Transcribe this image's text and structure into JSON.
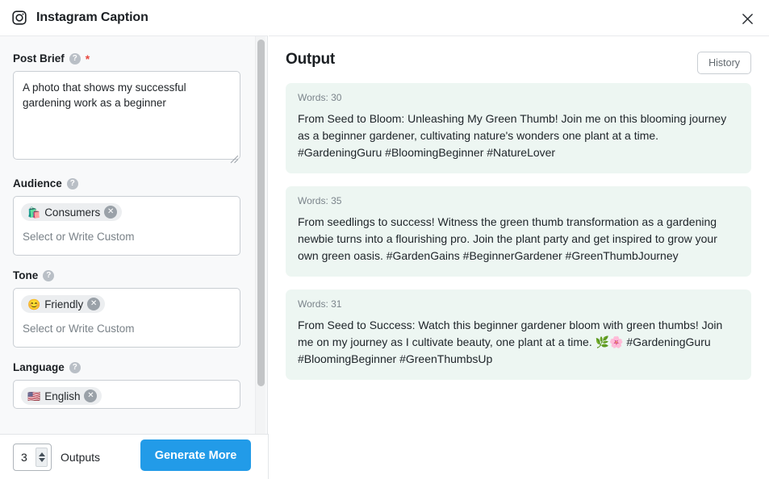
{
  "window": {
    "title": "Instagram Caption",
    "app_icon": "instagram-icon",
    "close_icon": "close-icon"
  },
  "form": {
    "post_brief": {
      "label": "Post Brief",
      "help_icon": "help-icon",
      "required_marker": "*",
      "value": "A photo that shows my successful gardening work as a beginner",
      "placeholder": ""
    },
    "audience": {
      "label": "Audience",
      "help_icon": "help-icon",
      "chips": [
        {
          "emoji": "🛍️",
          "label": "Consumers",
          "remove_icon": "close-circle-icon"
        }
      ],
      "placeholder": "Select or Write Custom"
    },
    "tone": {
      "label": "Tone",
      "help_icon": "help-icon",
      "chips": [
        {
          "emoji": "😊",
          "label": "Friendly",
          "remove_icon": "close-circle-icon"
        }
      ],
      "placeholder": "Select or Write Custom"
    },
    "language": {
      "label": "Language",
      "help_icon": "help-icon",
      "chips": [
        {
          "emoji": "🇺🇸",
          "label": "English",
          "remove_icon": "close-circle-icon"
        }
      ]
    }
  },
  "footer": {
    "outputs_count": "3",
    "outputs_label": "Outputs",
    "generate_label": "Generate More",
    "stepper_up_icon": "chevron-up-icon",
    "stepper_down_icon": "chevron-down-icon"
  },
  "output": {
    "title": "Output",
    "history_label": "History",
    "cards": [
      {
        "words_label": "Words: 30",
        "text": "From Seed to Bloom: Unleashing My Green Thumb! Join me on this blooming journey as a beginner gardener, cultivating nature's wonders one plant at a time. #GardeningGuru #BloomingBeginner #NatureLover"
      },
      {
        "words_label": "Words: 35",
        "text": "From seedlings to success! Witness the green thumb transformation as a gardening newbie turns into a flourishing pro. Join the plant party and get inspired to grow your own green oasis. #GardenGains #BeginnerGardener #GreenThumbJourney"
      },
      {
        "words_label": "Words: 31",
        "text": "From Seed to Success: Watch this beginner gardener bloom with green thumbs! Join me on my journey as I cultivate beauty, one plant at a time. 🌿🌸 #GardeningGuru #BloomingBeginner #GreenThumbsUp"
      }
    ]
  },
  "colors": {
    "accent": "#229be8",
    "card_bg": "#edf6f2",
    "panel_bg": "#f8f9fa",
    "required": "#e8483f"
  }
}
